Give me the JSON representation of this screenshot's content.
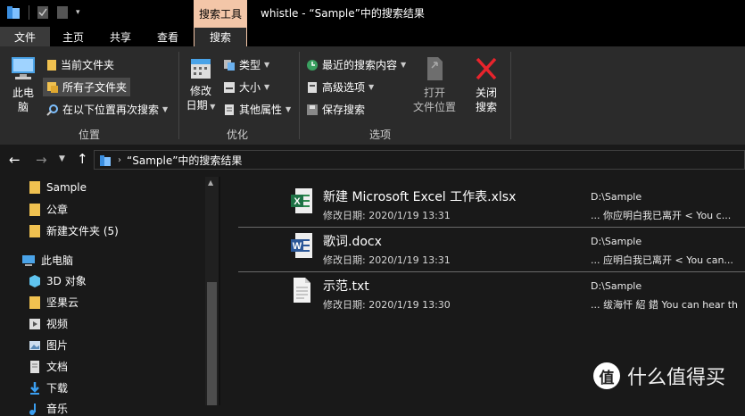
{
  "titlebar": {
    "context_tab": "搜索工具",
    "title": "whistle - “Sample”中的搜索结果"
  },
  "tabs": {
    "file": "文件",
    "home": "主页",
    "share": "共享",
    "view": "查看",
    "search": "搜索"
  },
  "ribbon": {
    "location": {
      "this_pc_line1": "此电",
      "this_pc_line2": "脑",
      "current_folder": "当前文件夹",
      "all_subfolders": "所有子文件夹",
      "search_again": "在以下位置再次搜索",
      "group_label": "位置"
    },
    "refine": {
      "date_modified_line1": "修改",
      "date_modified_line2": "日期",
      "kind": "类型",
      "size": "大小",
      "other_properties": "其他属性",
      "group_label": "优化"
    },
    "options": {
      "recent_searches": "最近的搜索内容",
      "advanced_options": "高级选项",
      "save_search": "保存搜索",
      "open_location_line1": "打开",
      "open_location_line2": "文件位置",
      "close_search_line1": "关闭",
      "close_search_line2": "搜索",
      "group_label": "选项"
    }
  },
  "address": {
    "path": "“Sample”中的搜索结果"
  },
  "tree": {
    "items": [
      {
        "label": "Sample"
      },
      {
        "label": "公章"
      },
      {
        "label": "新建文件夹 (5)"
      },
      {
        "label": "此电脑"
      },
      {
        "label": "3D 对象"
      },
      {
        "label": "坚果云"
      },
      {
        "label": "视频"
      },
      {
        "label": "图片"
      },
      {
        "label": "文档"
      },
      {
        "label": "下载"
      },
      {
        "label": "音乐"
      }
    ]
  },
  "results": [
    {
      "name": "新建 Microsoft Excel 工作表.xlsx",
      "modified": "修改日期: 2020/1/19 13:31",
      "path": "D:\\Sample",
      "snippet": "... 你应明白我已离开 < You c...",
      "icon": "excel-icon"
    },
    {
      "name": "歌词.docx",
      "modified": "修改日期: 2020/1/19 13:31",
      "path": "D:\\Sample",
      "snippet": "... 应明白我已离开 < You can...",
      "icon": "word-icon"
    },
    {
      "name": "示范.txt",
      "modified": "修改日期: 2020/1/19 13:30",
      "path": "D:\\Sample",
      "snippet": "... 绂海忓 紹 鍣 You can hear th",
      "icon": "text-file-icon"
    }
  ],
  "watermark": {
    "logo_char": "值",
    "text": "什么值得买"
  },
  "colors": {
    "context_tab": "#f3c6a8",
    "background": "#191919",
    "ribbon": "#2b2b2b",
    "folder": "#f0c150",
    "close_red": "#e8242c"
  }
}
